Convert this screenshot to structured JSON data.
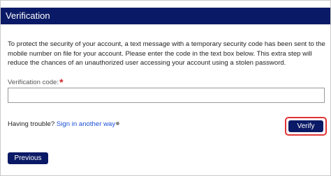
{
  "header": {
    "title": "Verification"
  },
  "main": {
    "instructions": "To protect the security of your account, a text message with a temporary security code has been sent to the mobile number on file for your account. Please enter the code in the text box below. This extra step will reduce the chances of an unauthorized user accessing your account using a stolen password.",
    "code_label": "Verification code:",
    "required_marker": "*",
    "code_value": "",
    "trouble_text": "Having trouble?",
    "trouble_link": "Sign in another way",
    "verify_label": "Verify",
    "previous_label": "Previous"
  },
  "colors": {
    "brand_navy": "#0b1a66",
    "link_blue": "#1a4fd6",
    "required_red": "#d42222",
    "highlight_red": "#e03434"
  },
  "icons": {
    "help": "info-icon"
  }
}
